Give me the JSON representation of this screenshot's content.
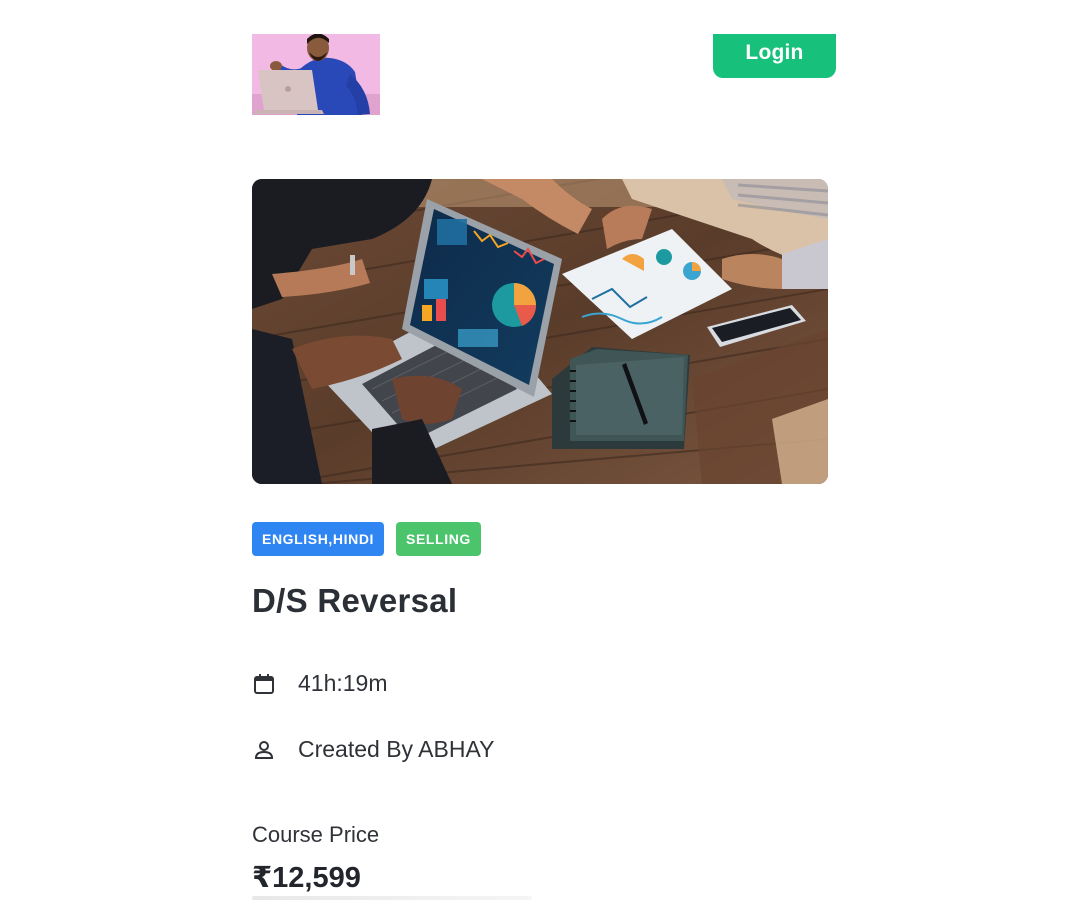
{
  "header": {
    "login_label": "Login",
    "logo_icon": "instructor-avatar-icon"
  },
  "hero": {
    "icon": "course-hero-image"
  },
  "course": {
    "tags": [
      {
        "label": "ENGLISH,HINDI",
        "color": "#2f86f2"
      },
      {
        "label": "SELLING",
        "color": "#4cc46c"
      }
    ],
    "title": "D/S Reversal",
    "duration": "41h:19m",
    "duration_icon": "calendar-icon",
    "author": "Created By ABHAY",
    "author_icon": "user-icon",
    "price_label": "Course Price",
    "price": "₹12,599"
  },
  "colors": {
    "accent": "#17c17b",
    "tag_blue": "#2f86f2",
    "tag_green": "#4cc46c"
  }
}
